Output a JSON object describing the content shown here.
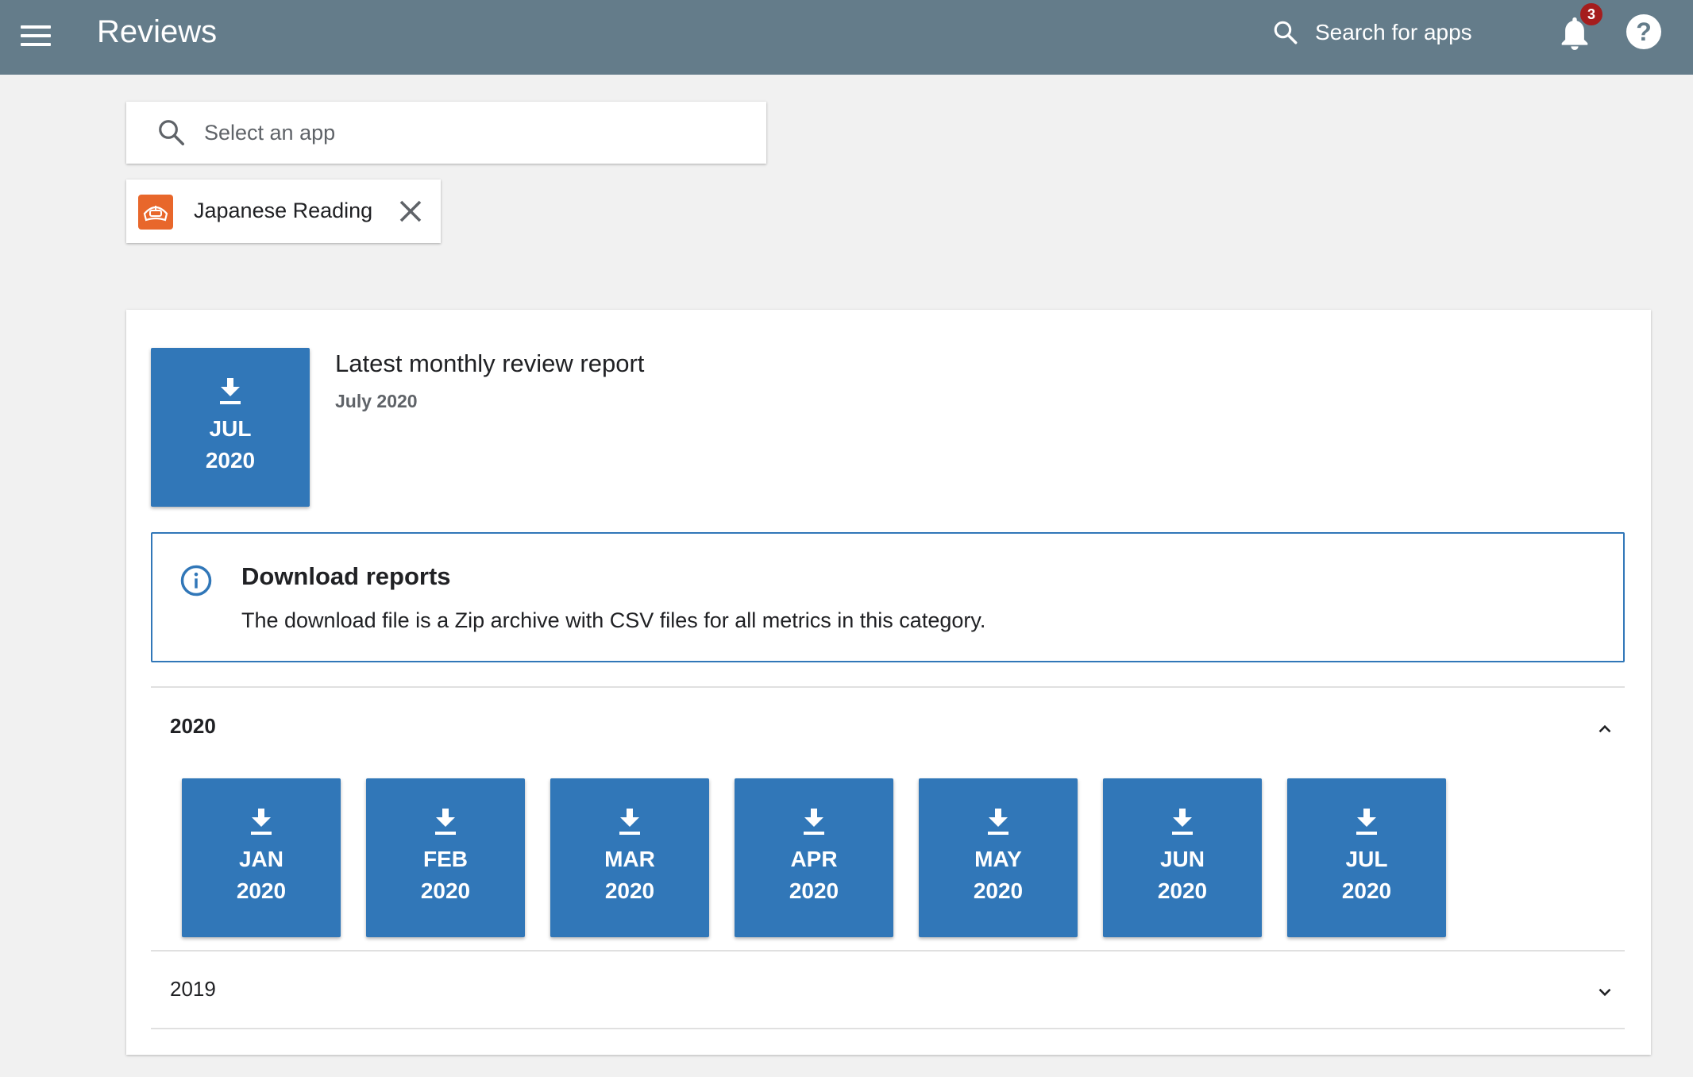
{
  "header": {
    "title": "Reviews",
    "search_label": "Search for apps",
    "notification_count": "3",
    "help_glyph": "?"
  },
  "app_select": {
    "placeholder": "Select an app"
  },
  "selected_app": {
    "name": "Japanese Reading",
    "icon_color": "#e8672b"
  },
  "latest_report": {
    "title": "Latest monthly review report",
    "subtitle": "July 2020",
    "tile": {
      "month": "JUL",
      "year": "2020"
    }
  },
  "info": {
    "title": "Download reports",
    "text": "The download file is a Zip archive with CSV files for all metrics in this category."
  },
  "years": [
    {
      "label": "2020",
      "expanded": true,
      "months": [
        {
          "month": "JAN",
          "year": "2020"
        },
        {
          "month": "FEB",
          "year": "2020"
        },
        {
          "month": "MAR",
          "year": "2020"
        },
        {
          "month": "APR",
          "year": "2020"
        },
        {
          "month": "MAY",
          "year": "2020"
        },
        {
          "month": "JUN",
          "year": "2020"
        },
        {
          "month": "JUL",
          "year": "2020"
        }
      ]
    },
    {
      "label": "2019",
      "expanded": false,
      "months": []
    }
  ],
  "colors": {
    "topbar": "#647c8a",
    "tile": "#3177b8",
    "badge": "#a51d1d"
  }
}
